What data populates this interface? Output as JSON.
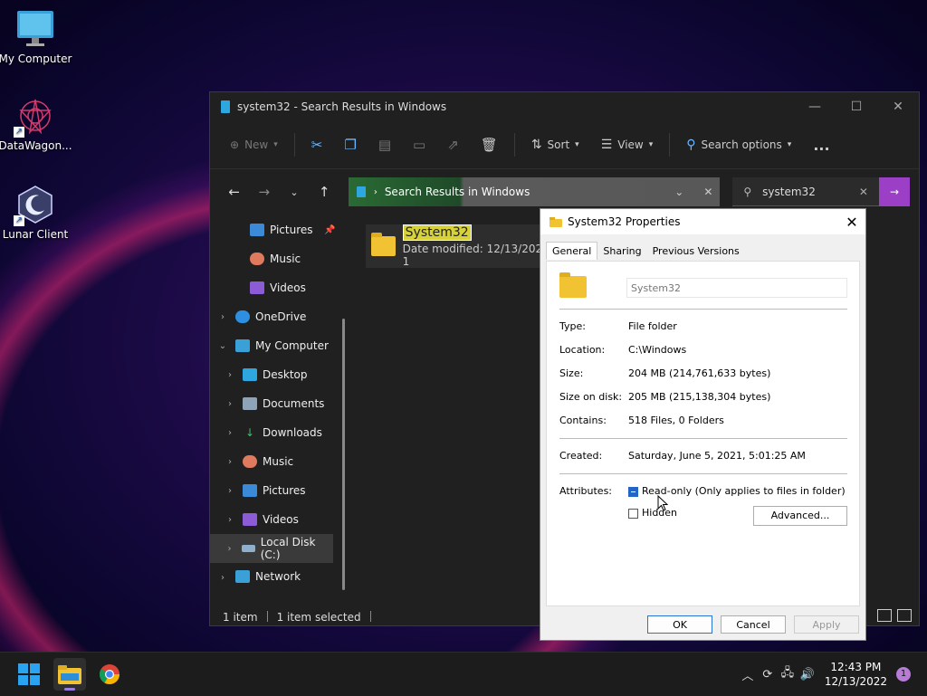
{
  "desktop": {
    "icons": [
      {
        "label": "My Computer"
      },
      {
        "label": "DataWagon..."
      },
      {
        "label": "Lunar Client"
      }
    ]
  },
  "explorer": {
    "title": "system32 - Search Results in Windows",
    "toolbar": {
      "new_label": "New",
      "sort_label": "Sort",
      "view_label": "View",
      "search_options_label": "Search options",
      "more_label": "..."
    },
    "address": {
      "crumb": "Search Results in Windows"
    },
    "search": {
      "value": "system32"
    },
    "sidebar": {
      "items": [
        {
          "label": "Pictures"
        },
        {
          "label": "Music"
        },
        {
          "label": "Videos"
        },
        {
          "label": "OneDrive"
        },
        {
          "label": "My Computer"
        },
        {
          "label": "Desktop"
        },
        {
          "label": "Documents"
        },
        {
          "label": "Downloads"
        },
        {
          "label": "Music"
        },
        {
          "label": "Pictures"
        },
        {
          "label": "Videos"
        },
        {
          "label": "Local Disk (C:)"
        },
        {
          "label": "Network"
        }
      ]
    },
    "result": {
      "name": "System32",
      "meta": "Date modified: 12/13/2022 1"
    },
    "status": {
      "count": "1 item",
      "selected": "1 item selected"
    }
  },
  "properties": {
    "title": "System32 Properties",
    "tabs": [
      "General",
      "Sharing",
      "Previous Versions"
    ],
    "name_value": "System32",
    "rows": {
      "type_k": "Type:",
      "type_v": "File folder",
      "location_k": "Location:",
      "location_v": "C:\\Windows",
      "size_k": "Size:",
      "size_v": "204 MB (214,761,633 bytes)",
      "sod_k": "Size on disk:",
      "sod_v": "205 MB (215,138,304 bytes)",
      "contains_k": "Contains:",
      "contains_v": "518 Files, 0 Folders",
      "created_k": "Created:",
      "created_v": "Saturday, June 5, 2021, 5:01:25 AM",
      "attributes_k": "Attributes:"
    },
    "readonly_label": "Read-only (Only applies to files in folder)",
    "hidden_label": "Hidden",
    "advanced_label": "Advanced...",
    "ok_label": "OK",
    "cancel_label": "Cancel",
    "apply_label": "Apply"
  },
  "taskbar": {
    "time": "12:43 PM",
    "date": "12/13/2022",
    "notifications": "1"
  }
}
